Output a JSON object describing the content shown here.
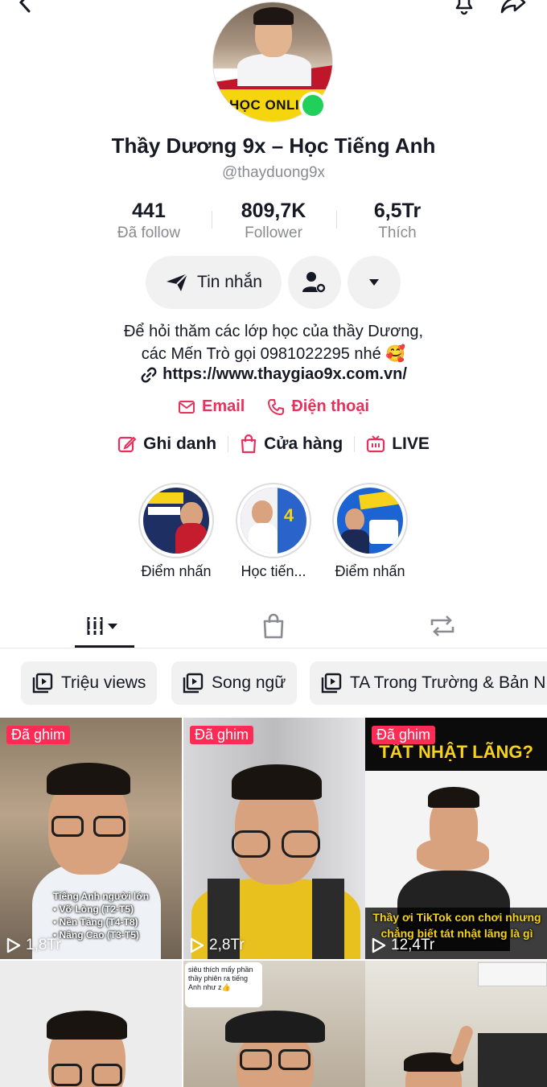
{
  "profile": {
    "name": "Thầy Dương 9x – Học Tiếng Anh",
    "handle": "@thayduong9x",
    "avatar_text": "HỌC ONLI"
  },
  "stats": [
    {
      "value": "441",
      "label": "Đã follow"
    },
    {
      "value": "809,7K",
      "label": "Follower"
    },
    {
      "value": "6,5Tr",
      "label": "Thích"
    }
  ],
  "buttons": {
    "message": "Tin nhắn"
  },
  "bio": {
    "line1": "Để hỏi thăm các lớp học của thầy Dương,",
    "line2": "các Mến Trò gọi 0981022295 nhé 🥰",
    "link": "https://www.thaygiao9x.com.vn/"
  },
  "contacts": {
    "email": "Email",
    "phone": "Điện thoại"
  },
  "actions": {
    "register": "Ghi danh",
    "shop": "Cửa hàng",
    "live": "LIVE"
  },
  "highlights": [
    {
      "label": "Điểm nhấn"
    },
    {
      "label": "Học tiến..."
    },
    {
      "label": "Điểm nhấn"
    }
  ],
  "playlists": [
    {
      "label": "Triệu views"
    },
    {
      "label": "Song ngữ"
    },
    {
      "label": "TA Trong Trường & Bản N"
    }
  ],
  "videos": [
    {
      "pinned": "Đã ghim",
      "views": "1,8Tr",
      "caption": "Tiếng Anh người lớn\n• Vỡ Lòng (T2-T5)\n• Nền Tảng (T4-T8)\n• Nâng Cao (T3-T5)"
    },
    {
      "pinned": "Đã ghim",
      "views": "2,8Tr",
      "caption": ""
    },
    {
      "pinned": "Đã ghim",
      "views": "12,4Tr",
      "title": "TẤT NHẬT LÃNG?",
      "caption": "Thầy ơi TikTok con chơi nhưng chẳng biết tát nhật lãng là gì"
    },
    {
      "caption": ""
    },
    {
      "caption": "siêu thích mấy phần thầy phiên ra tiếng Anh như z👍"
    },
    {
      "caption": ""
    }
  ]
}
